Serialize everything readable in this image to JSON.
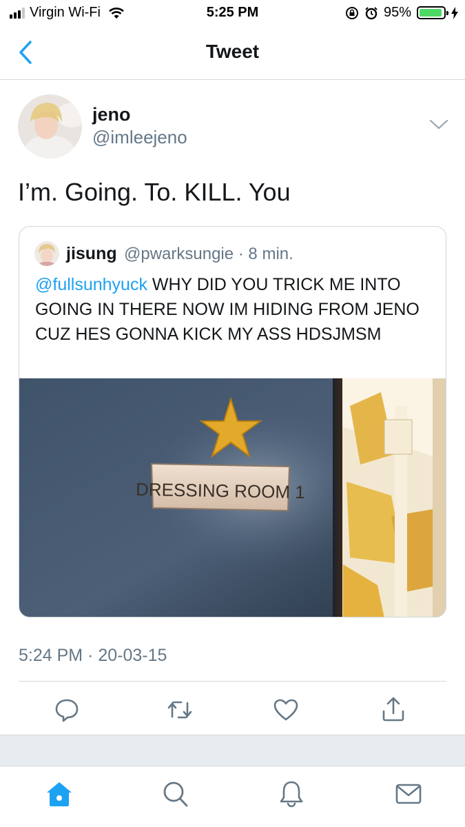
{
  "status_bar": {
    "carrier": "Virgin Wi-Fi",
    "time": "5:25 PM",
    "battery_percent": "95%",
    "battery_level": 0.95
  },
  "nav": {
    "title": "Tweet",
    "back_icon": "chevron-left-icon"
  },
  "tweet": {
    "author_name": "jeno",
    "author_handle": "@imleejeno",
    "text": "I’m. Going. To. KILL. You",
    "timestamp": "5:24 PM · 20-03-15"
  },
  "quoted_tweet": {
    "author_name": "jisung",
    "meta": "@pwarksungie · 8 min.",
    "mention": "@fullsunhyuck",
    "text": " WHY DID YOU TRICK ME INTO GOING IN THERE NOW IM HIDING FROM JENO CUZ HES GONNA KICK MY ASS HDSJMSM",
    "image_sign_text": "DRESSING ROOM 1"
  },
  "actions": [
    "reply-icon",
    "retweet-icon",
    "like-icon",
    "share-icon"
  ],
  "tab_bar": [
    "home-icon",
    "search-icon",
    "notifications-icon",
    "messages-icon"
  ],
  "colors": {
    "accent": "#1da1f2",
    "secondary_text": "#657786",
    "battery_green": "#4cd964",
    "background_band": "#e6ecf0"
  }
}
